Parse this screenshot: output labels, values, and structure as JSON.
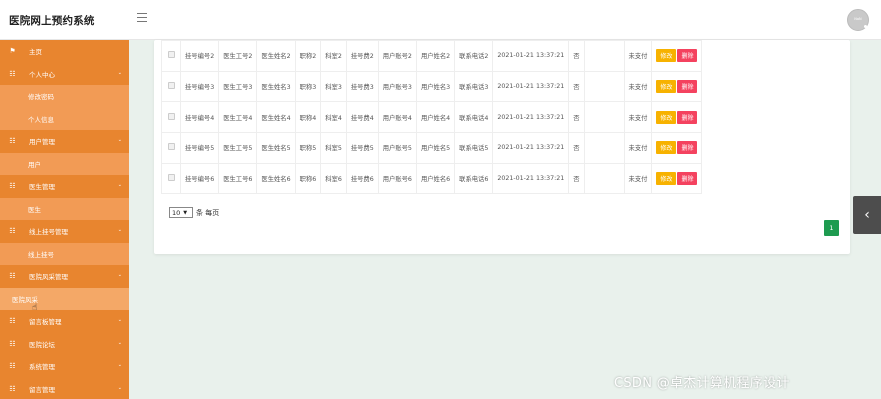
{
  "app": {
    "title": "医院网上预约系统",
    "avatar_text": "NaN"
  },
  "sidebar": [
    {
      "type": "cat",
      "icon": "flag-icon",
      "glyph": "⚑",
      "label": "主页",
      "arrow": false
    },
    {
      "type": "cat",
      "icon": "grid-icon",
      "glyph": "☷",
      "label": "个人中心",
      "arrow": true
    },
    {
      "type": "sub",
      "label": "修改密码"
    },
    {
      "type": "sub",
      "label": "个人信息"
    },
    {
      "type": "cat",
      "icon": "grid-icon",
      "glyph": "☷",
      "label": "用户管理",
      "arrow": true
    },
    {
      "type": "sub",
      "label": "用户"
    },
    {
      "type": "cat",
      "icon": "grid-icon",
      "glyph": "☷",
      "label": "医生管理",
      "arrow": true
    },
    {
      "type": "sub",
      "label": "医生"
    },
    {
      "type": "cat",
      "icon": "grid-icon",
      "glyph": "☷",
      "label": "线上挂号管理",
      "arrow": true
    },
    {
      "type": "sub",
      "label": "线上挂号"
    },
    {
      "type": "cat",
      "icon": "grid-icon",
      "glyph": "☷",
      "label": "医院风采管理",
      "arrow": true
    },
    {
      "type": "active-sub",
      "label": "医院风采"
    },
    {
      "type": "cat",
      "icon": "grid-icon",
      "glyph": "☷",
      "label": "留言板管理",
      "arrow": true
    },
    {
      "type": "cat",
      "icon": "grid-icon",
      "glyph": "☷",
      "label": "医院论坛",
      "arrow": true
    },
    {
      "type": "cat",
      "icon": "grid-icon",
      "glyph": "☷",
      "label": "系统管理",
      "arrow": true
    },
    {
      "type": "cat",
      "icon": "grid-icon",
      "glyph": "☷",
      "label": "留言管理",
      "arrow": true
    }
  ],
  "table": {
    "rows": [
      [
        "挂号编号2",
        "医生工号2",
        "医生姓名2",
        "职称2",
        "科室2",
        "挂号费2",
        "用户账号2",
        "用户姓名2",
        "联系电话2",
        "2021-01-21 13:37:21",
        "否",
        "",
        "未支付"
      ],
      [
        "挂号编号3",
        "医生工号3",
        "医生姓名3",
        "职称3",
        "科室3",
        "挂号费3",
        "用户账号3",
        "用户姓名3",
        "联系电话3",
        "2021-01-21 13:37:21",
        "否",
        "",
        "未支付"
      ],
      [
        "挂号编号4",
        "医生工号4",
        "医生姓名4",
        "职称4",
        "科室4",
        "挂号费4",
        "用户账号4",
        "用户姓名4",
        "联系电话4",
        "2021-01-21 13:37:21",
        "否",
        "",
        "未支付"
      ],
      [
        "挂号编号5",
        "医生工号5",
        "医生姓名5",
        "职称5",
        "科室5",
        "挂号费5",
        "用户账号5",
        "用户姓名5",
        "联系电话5",
        "2021-01-21 13:37:21",
        "否",
        "",
        "未支付"
      ],
      [
        "挂号编号6",
        "医生工号6",
        "医生姓名6",
        "职称6",
        "科室6",
        "挂号费6",
        "用户账号6",
        "用户姓名6",
        "联系电话6",
        "2021-01-21 13:37:21",
        "否",
        "",
        "未支付"
      ]
    ],
    "edit_label": "修改",
    "delete_label": "删除"
  },
  "pager": {
    "page_size": "10",
    "per_page_label": "条 每页",
    "current_page": "1"
  },
  "side_tab_glyph": "‹",
  "watermark": "CSDN @卓杰计算机程序设计",
  "colors": {
    "sidebar": "#ee8a3e",
    "edit": "#f7b200",
    "delete": "#f4425f",
    "page": "#1e9b50"
  }
}
